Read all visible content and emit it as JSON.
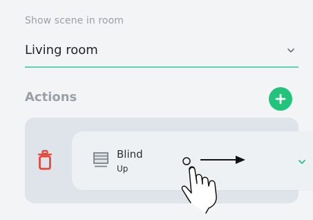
{
  "form": {
    "room_label": "Show scene in room",
    "room_value": "Living room"
  },
  "actions": {
    "title": "Actions",
    "items": [
      {
        "device": "Blind",
        "state": "Up"
      }
    ]
  },
  "colors": {
    "accent_green": "#22c37a",
    "underline_mint": "#5fd1b0",
    "delete_red": "#e5483d",
    "row_bg": "#dfe4ea",
    "card_bg": "#eef1f4"
  },
  "icons": {
    "room_dropdown": "chevron-down-icon",
    "add_action": "plus-circle-icon",
    "delete_action": "trash-icon",
    "device": "blind-icon",
    "expand_action": "chevron-down-icon",
    "gesture": "swipe-right-hand-icon"
  }
}
